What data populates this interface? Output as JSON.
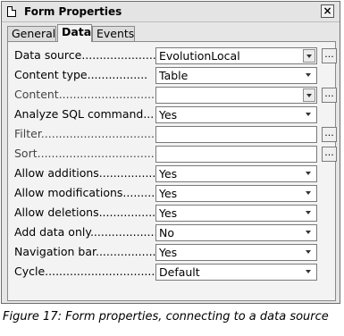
{
  "window": {
    "title": "Form Properties",
    "close_label": "×"
  },
  "tabs": [
    {
      "label": "General"
    },
    {
      "label": "Data"
    },
    {
      "label": "Events"
    }
  ],
  "rows": [
    {
      "label": "Data source.....................",
      "value": "EvolutionLocal",
      "has_dropdown": true,
      "has_button": true,
      "button_label": "..."
    },
    {
      "label": "Content type.................",
      "value": "Table",
      "has_dropdown": true,
      "has_button": false
    },
    {
      "label": "Content..............................",
      "value": "",
      "has_dropdown": true,
      "has_button": true,
      "button_label": "..."
    },
    {
      "label": "Analyze SQL command...",
      "value": "Yes",
      "has_dropdown": true,
      "has_button": false
    },
    {
      "label": "Filter.....................................",
      "value": "",
      "has_dropdown": false,
      "has_button": true,
      "button_label": "..."
    },
    {
      "label": "Sort.........................................",
      "value": "",
      "has_dropdown": false,
      "has_button": true,
      "button_label": "..."
    },
    {
      "label": "Allow additions.................",
      "value": "Yes",
      "has_dropdown": true,
      "has_button": false
    },
    {
      "label": "Allow modifications............",
      "value": "Yes",
      "has_dropdown": true,
      "has_button": false
    },
    {
      "label": "Allow deletions..................",
      "value": "Yes",
      "has_dropdown": true,
      "has_button": false
    },
    {
      "label": "Add data only...................",
      "value": "No",
      "has_dropdown": true,
      "has_button": false
    },
    {
      "label": "Navigation bar.................",
      "value": "Yes",
      "has_dropdown": true,
      "has_button": false
    },
    {
      "label": "Cycle...........................................",
      "value": "Default",
      "has_dropdown": true,
      "has_button": false
    }
  ],
  "caption": "Figure 17: Form properties, connecting to a data source"
}
